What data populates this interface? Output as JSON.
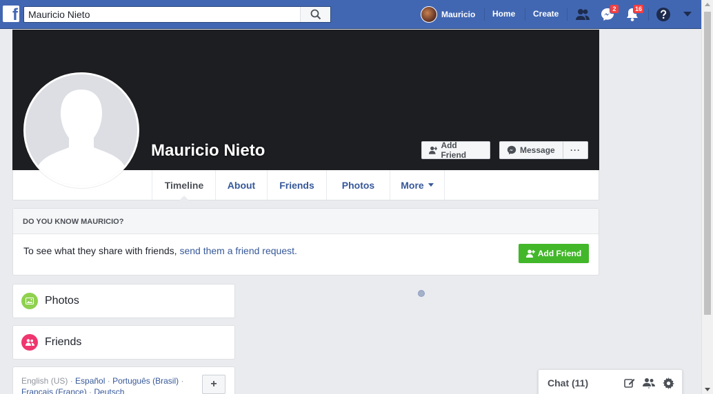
{
  "topbar": {
    "logo": "f",
    "search_value": "Mauricio Nieto",
    "user_name": "Mauricio",
    "home_label": "Home",
    "create_label": "Create",
    "messages_badge": "2",
    "notifications_badge": "16"
  },
  "profile": {
    "name": "Mauricio Nieto",
    "add_friend_label": "Add Friend",
    "message_label": "Message",
    "more_dots": "···"
  },
  "tabs": [
    {
      "label": "Timeline",
      "active": true
    },
    {
      "label": "About"
    },
    {
      "label": "Friends"
    },
    {
      "label": "Photos"
    },
    {
      "label": "More"
    }
  ],
  "know": {
    "heading": "DO YOU KNOW MAURICIO?",
    "text": "To see what they share with friends, ",
    "link": "send them a friend request.",
    "button": "Add Friend"
  },
  "cards": {
    "photos": "Photos",
    "friends": "Friends"
  },
  "languages": {
    "current": "English (US)",
    "sep": " · ",
    "espanol": "Español",
    "portugues": "Português (Brasil)",
    "francais": "Français (France)",
    "deutsch": "Deutsch",
    "plus": "+"
  },
  "chat": {
    "title": "Chat (11)"
  },
  "colors": {
    "brand": "#4267b2",
    "green": "#42b72a",
    "badge": "#fa3e3e",
    "link": "#365899"
  }
}
